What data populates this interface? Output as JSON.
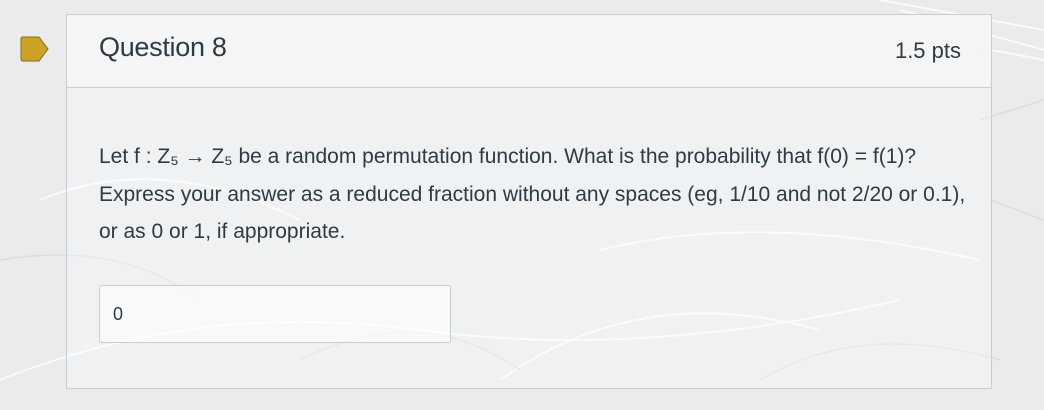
{
  "question": {
    "title": "Question 8",
    "points": "1.5 pts",
    "text": "Let f : Z₅ → Z₅ be a random permutation function. What is the probability that f(0) = f(1)? Express your answer as a reduced fraction without any spaces (eg, 1/10 and not 2/20 or 0.1), or as 0 or 1, if appropriate.",
    "answer_value": "0"
  },
  "colors": {
    "flag": "#c9a227",
    "text": "#2d3b45",
    "border": "#c7cdd1",
    "header_bg": "#f5f5f5"
  },
  "icons": {
    "flag": "flag-icon"
  }
}
